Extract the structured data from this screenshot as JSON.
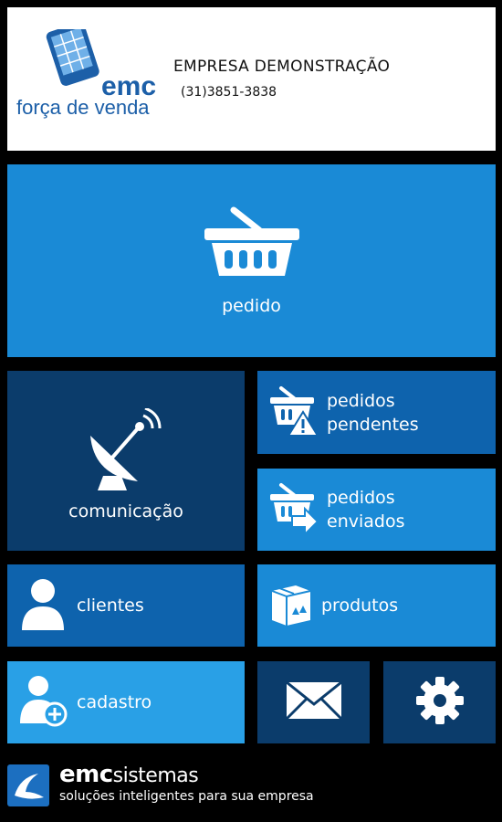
{
  "header": {
    "logo_brand": "emc",
    "logo_product": "força de venda",
    "company_name": "EMPRESA DEMONSTRAÇÃO",
    "company_phone": "(31)3851-3838"
  },
  "tiles": {
    "pedido": {
      "label": "pedido",
      "icon": "basket-icon"
    },
    "comunicacao": {
      "label": "comunicação",
      "icon": "satellite-dish-icon"
    },
    "pendentes": {
      "line1": "pedidos",
      "line2": "pendentes",
      "icon": "basket-warning-icon"
    },
    "enviados": {
      "line1": "pedidos",
      "line2": "enviados",
      "icon": "basket-send-icon"
    },
    "clientes": {
      "label": "clientes",
      "icon": "user-icon"
    },
    "produtos": {
      "label": "produtos",
      "icon": "box-icon"
    },
    "cadastro": {
      "label": "cadastro",
      "icon": "user-add-icon"
    },
    "mensagem": {
      "icon": "envelope-icon"
    },
    "config": {
      "icon": "gear-icon"
    }
  },
  "footer": {
    "brand_bold": "emc",
    "brand_light": "sistemas",
    "tagline": "soluções inteligentes para sua empresa"
  },
  "colors": {
    "tile_light": "#1a8ad6",
    "tile_medium": "#0e63ad",
    "tile_dark": "#0b3c6b",
    "tile_sky": "#29a0e6",
    "logo_blue": "#1c5fa8"
  }
}
